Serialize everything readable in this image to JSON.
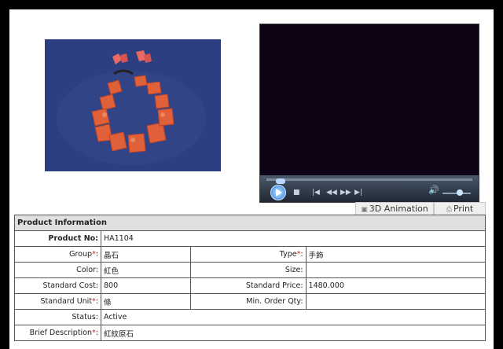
{
  "tabs": {
    "animation": "3D Animation",
    "print": "Print"
  },
  "section_title": "Product Information",
  "product_no": {
    "label": "Product No:",
    "value": "HA1104"
  },
  "group": {
    "label": "Group",
    "req": "*",
    "colon": ":",
    "value": "晶石"
  },
  "type": {
    "label": "Type",
    "req": "*",
    "colon": ":",
    "value": "手飾"
  },
  "color": {
    "label": "Color:",
    "value": "紅色"
  },
  "size": {
    "label": "Size:",
    "value": ""
  },
  "standard_cost": {
    "label": "Standard Cost:",
    "value": "800"
  },
  "standard_price": {
    "label": "Standard Price:",
    "value": "1480.000"
  },
  "standard_unit": {
    "label": "Standard Unit",
    "req": "*",
    "colon": ":",
    "value": "條"
  },
  "min_order_qty": {
    "label": "Min. Order Qty:",
    "value": ""
  },
  "status": {
    "label": "Status:",
    "value": "Active"
  },
  "brief_description": {
    "label": "Brief Description",
    "req": "*",
    "colon": ":",
    "value": "紅紋原石"
  },
  "colors": {
    "photo_bg": "#2d3f80",
    "bead": "#e0603a",
    "player_bg": "#0f0416",
    "header_bg": "#e0e0e0",
    "required": "#d02020"
  },
  "icons": [
    "play-icon",
    "stop-icon",
    "previous-icon",
    "rewind-icon",
    "fast-forward-icon",
    "next-icon",
    "volume-icon",
    "cube-icon",
    "printer-icon"
  ]
}
